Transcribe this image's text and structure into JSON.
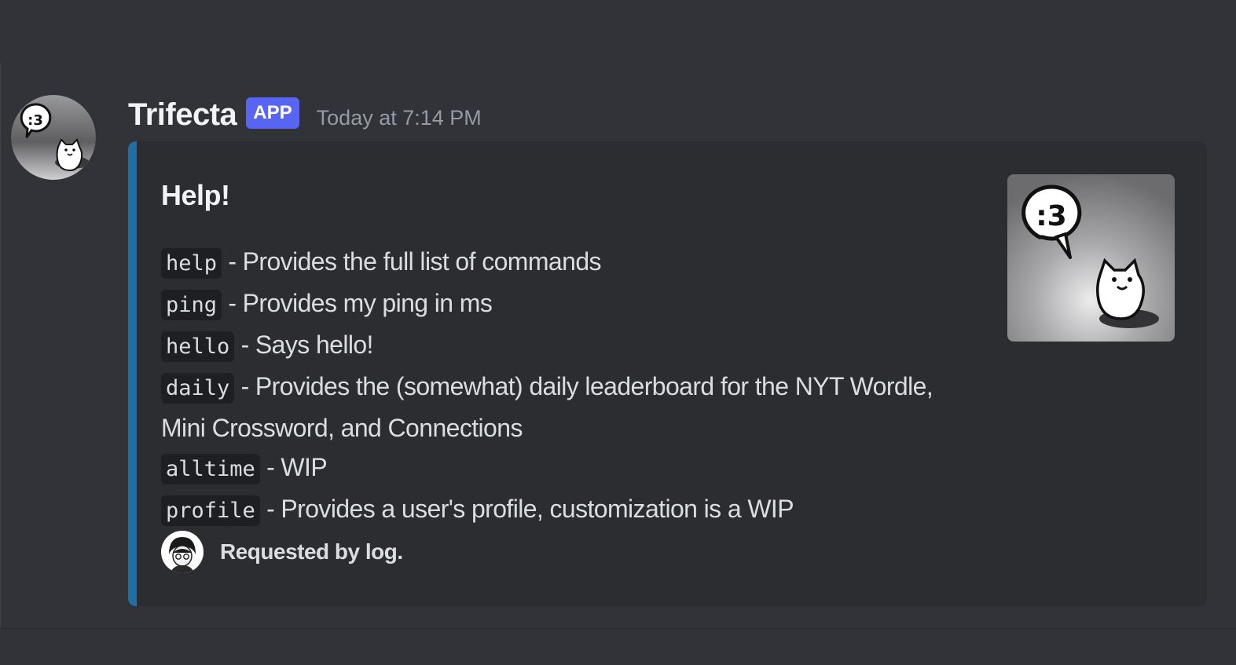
{
  "message": {
    "author": "Trifecta",
    "badge": "APP",
    "timestamp": "Today at 7:14 PM",
    "avatar_icon": "speech-bubble-cat-avatar-icon"
  },
  "embed": {
    "accent_color": "#1f6fa5",
    "title": "Help!",
    "commands": [
      {
        "name": "help",
        "description": " - Provides the full list of commands"
      },
      {
        "name": "ping",
        "description": " - Provides my ping in ms"
      },
      {
        "name": "hello",
        "description": " - Says hello!"
      },
      {
        "name": "daily",
        "description": " - Provides the (somewhat) daily leaderboard for the NYT Wordle, Mini Crossword, and Connections"
      },
      {
        "name": "alltime",
        "description": " - WIP"
      },
      {
        "name": "profile",
        "description": " - Provides a user's profile, customization is a WIP"
      }
    ],
    "thumbnail_icon": "speech-bubble-cat-thumbnail-icon",
    "footer": {
      "text": "Requested by log.",
      "icon": "user-avatar-icon"
    }
  },
  "colors": {
    "background": "#313338",
    "embed_background": "#2b2d31",
    "badge": "#5865f2"
  }
}
